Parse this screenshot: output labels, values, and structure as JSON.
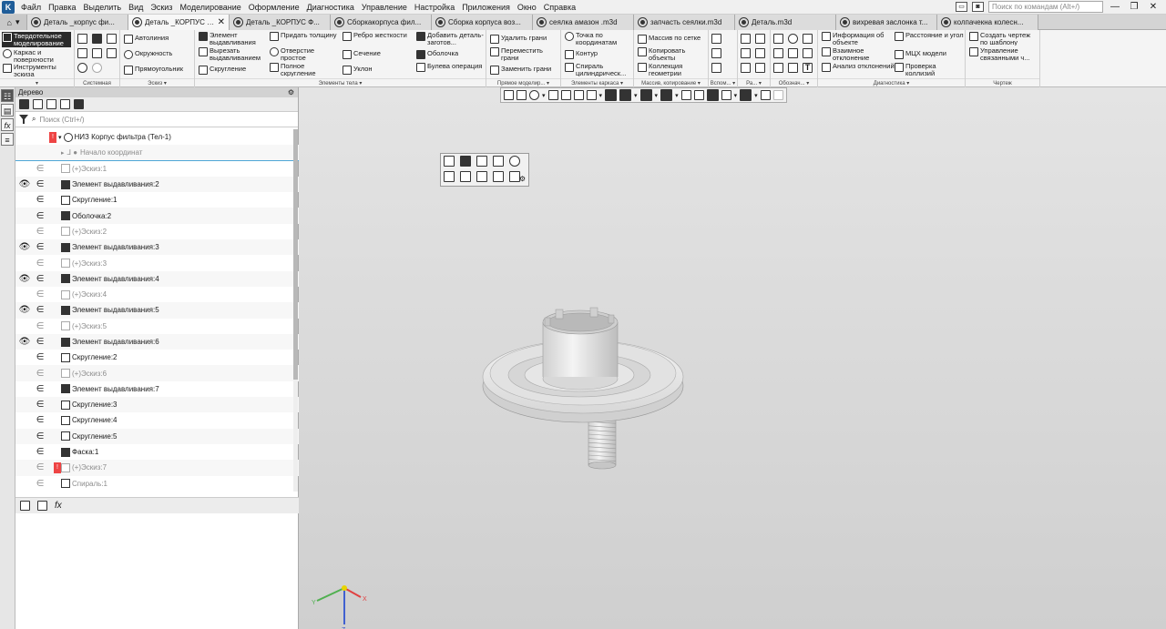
{
  "app": {
    "logo": "K"
  },
  "menu": {
    "items": [
      "Файл",
      "Правка",
      "Выделить",
      "Вид",
      "Эскиз",
      "Моделирование",
      "Оформление",
      "Диагностика",
      "Управление",
      "Настройка",
      "Приложения",
      "Окно",
      "Справка"
    ],
    "search_placeholder": "Поиск по командам (Alt+/)"
  },
  "tabs": [
    {
      "label": "Деталь _корпус фи...",
      "active": false
    },
    {
      "label": "Деталь _КОРПУС Ф...",
      "active": true
    },
    {
      "label": "Деталь _КОРПУС Ф...",
      "active": false
    },
    {
      "label": "Сборкакорпуса фил...",
      "active": false
    },
    {
      "label": "Сборка корпуса воз...",
      "active": false
    },
    {
      "label": "сеялка амазон .m3d",
      "active": false
    },
    {
      "label": "запчасть сеялки.m3d",
      "active": false
    },
    {
      "label": "Деталь.m3d",
      "active": false
    },
    {
      "label": "вихревая заслонка т...",
      "active": false
    },
    {
      "label": "колпачекна колесн...",
      "active": false
    }
  ],
  "ribbon": {
    "modes": [
      "Твердотельное моделирование",
      "Каркас и поверхности",
      "Инструменты эскиза"
    ],
    "system_footer": "Системная",
    "sketch": {
      "items": [
        "Автолиния",
        "Окружность",
        "Прямоугольник"
      ],
      "footer": "Эскиз"
    },
    "body_elements": {
      "items": [
        "Элемент выдавливания",
        "Вырезать выдавливанием",
        "Скругление",
        "Придать толщину",
        "Отверстие простое",
        "Полное скругление",
        "Ребро жесткости",
        "Сечение",
        "Уклон",
        "Добавить деталь-заготов...",
        "Оболочка",
        "Булева операция"
      ],
      "footer": "Элементы тела"
    },
    "direct": {
      "items": [
        "Удалить грани",
        "Переместить грани",
        "Заменить грани"
      ],
      "footer": "Прямое моделир..."
    },
    "frame": {
      "items": [
        "Точка по координатам",
        "Контур",
        "Спираль цилиндрическ..."
      ],
      "footer": "Элементы каркаса"
    },
    "array": {
      "items": [
        "Массив по сетке",
        "Копировать объекты",
        "Коллекция геометрии"
      ],
      "footer": "Массив, копирование"
    },
    "aux_footer": "Вспом...",
    "ra_footer": "Ра...",
    "designations_footer": "Обознач...",
    "diagnostics": {
      "items": [
        "Информация об объекте",
        "Взаимное отклонение",
        "Анализ отклонений",
        "Расстояние и угол",
        "МЦХ модели",
        "Проверка коллизий"
      ],
      "footer": "Диагностика"
    },
    "drawing": {
      "items": [
        "Создать чертеж по шаблону",
        "Управление связанными ч..."
      ],
      "footer": "Чертеж"
    }
  },
  "tree": {
    "title": "Дерево",
    "search_placeholder": "Поиск (Ctrl+/)",
    "root": "НИЗ Корпус фильтра (Тел-1)",
    "origin": "Начало координат",
    "items": [
      {
        "label": "(+)Эскиз:1",
        "grey": true,
        "eye": false,
        "icon": "sketch"
      },
      {
        "label": "Элемент выдавливания:2",
        "grey": false,
        "eye": true,
        "icon": "extrude"
      },
      {
        "label": "Скругление:1",
        "grey": false,
        "eye": false,
        "icon": "fillet"
      },
      {
        "label": "Оболочка:2",
        "grey": false,
        "eye": false,
        "icon": "shell"
      },
      {
        "label": "(+)Эскиз:2",
        "grey": true,
        "eye": false,
        "icon": "sketch"
      },
      {
        "label": "Элемент выдавливания:3",
        "grey": false,
        "eye": true,
        "icon": "extrude"
      },
      {
        "label": "(+)Эскиз:3",
        "grey": true,
        "eye": false,
        "icon": "sketch"
      },
      {
        "label": "Элемент выдавливания:4",
        "grey": false,
        "eye": true,
        "icon": "extrude"
      },
      {
        "label": "(+)Эскиз:4",
        "grey": true,
        "eye": false,
        "icon": "sketch"
      },
      {
        "label": "Элемент выдавливания:5",
        "grey": false,
        "eye": true,
        "icon": "extrude"
      },
      {
        "label": "(+)Эскиз:5",
        "grey": true,
        "eye": false,
        "icon": "sketch"
      },
      {
        "label": "Элемент выдавливания:6",
        "grey": false,
        "eye": true,
        "icon": "extrude"
      },
      {
        "label": "Скругление:2",
        "grey": false,
        "eye": false,
        "icon": "fillet"
      },
      {
        "label": "(+)Эскиз:6",
        "grey": true,
        "eye": false,
        "icon": "sketch"
      },
      {
        "label": "Элемент выдавливания:7",
        "grey": false,
        "eye": false,
        "icon": "extrude"
      },
      {
        "label": "Скругление:3",
        "grey": false,
        "eye": false,
        "icon": "fillet"
      },
      {
        "label": "Скругление:4",
        "grey": false,
        "eye": false,
        "icon": "fillet"
      },
      {
        "label": "Скругление:5",
        "grey": false,
        "eye": false,
        "icon": "fillet"
      },
      {
        "label": "Фаска:1",
        "grey": false,
        "eye": false,
        "icon": "chamfer"
      },
      {
        "label": "(+)Эскиз:7",
        "grey": true,
        "eye": false,
        "icon": "sketch",
        "error": true
      },
      {
        "label": "Спираль:1",
        "grey": true,
        "eye": false,
        "icon": "spiral"
      }
    ]
  },
  "axes": {
    "x": "X",
    "y": "Y",
    "z": "Z"
  },
  "colors": {
    "active_mode": "#2b2b2b",
    "error": "#e44444",
    "axis_x": "#e04040",
    "axis_y": "#50b050",
    "axis_z": "#4060d0"
  }
}
